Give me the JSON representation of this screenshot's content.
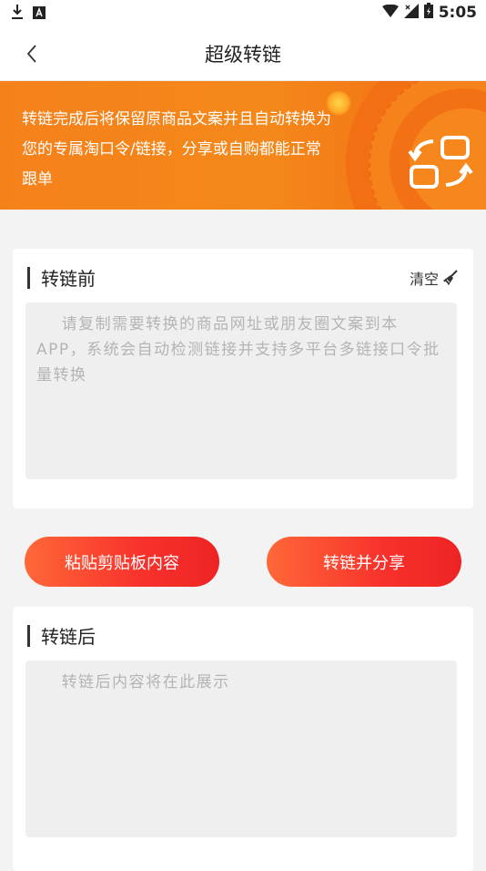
{
  "status_bar": {
    "time": "5:05"
  },
  "nav": {
    "title": "超级转链"
  },
  "banner": {
    "text": "转链完成后将保留原商品文案并且自动转换为您的专属淘口令/链接，分享或自购都能正常跟单"
  },
  "before_section": {
    "title": "转链前",
    "clear_label": "清空",
    "input_value": "",
    "placeholder": "    请复制需要转换的商品网址或朋友圈文案到本APP，系统会自动检测链接并支持多平台多链接口令批量转换"
  },
  "buttons": {
    "paste_label": "粘贴剪贴板内容",
    "convert_share_label": "转链并分享"
  },
  "after_section": {
    "title": "转链后",
    "output_value": "",
    "placeholder": "    转链后内容将在此展示"
  },
  "colors": {
    "banner_orange": "#f5811b",
    "button_red": "#f8312c",
    "button_orange": "#ff6838"
  }
}
